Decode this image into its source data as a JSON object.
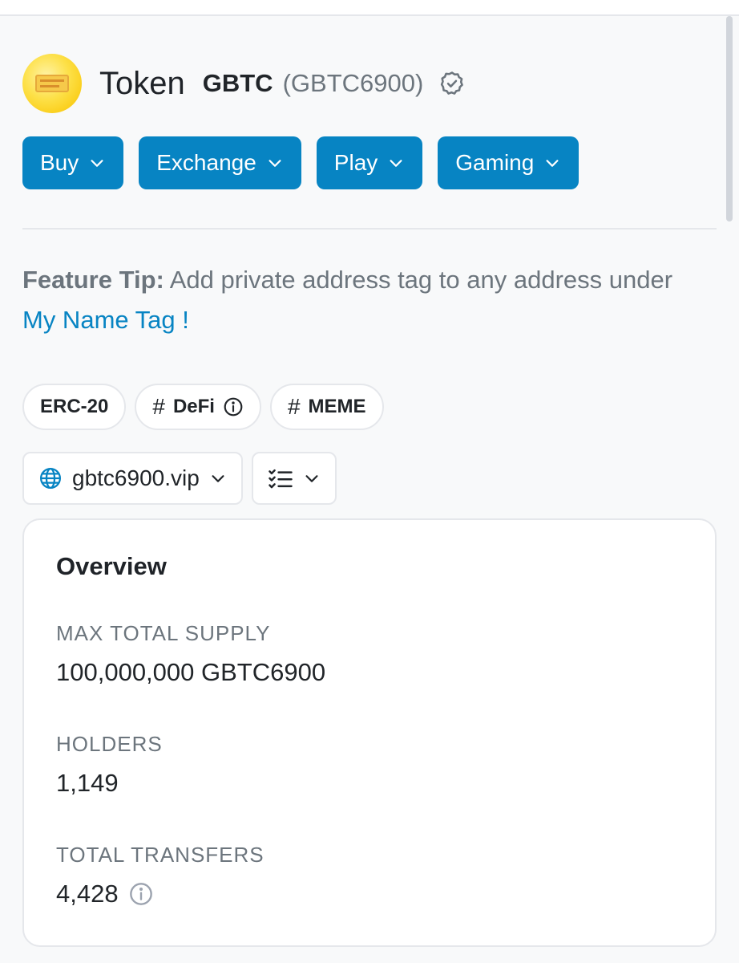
{
  "token": {
    "title": "Token",
    "symbol": "GBTC",
    "symbol_paren": "(GBTC6900)",
    "verified_icon": "verified-badge-icon"
  },
  "actions": [
    {
      "label": "Buy"
    },
    {
      "label": "Exchange"
    },
    {
      "label": "Play"
    },
    {
      "label": "Gaming"
    }
  ],
  "tip": {
    "prefix": "Feature Tip:",
    "text": " Add private address tag to any address under ",
    "link": "My Name Tag !"
  },
  "tags": {
    "standard": "ERC-20",
    "defi": "DeFi",
    "meme": "MEME",
    "hash": "#"
  },
  "links": {
    "website": "gbtc6900.vip"
  },
  "overview": {
    "title": "Overview",
    "max_supply_label": "MAX TOTAL SUPPLY",
    "max_supply_value": "100,000,000 GBTC6900",
    "holders_label": "HOLDERS",
    "holders_value": "1,149",
    "transfers_label": "TOTAL TRANSFERS",
    "transfers_value": "4,428"
  },
  "colors": {
    "accent": "#0784c3",
    "muted": "#6c757d",
    "logo": "#facc15"
  }
}
